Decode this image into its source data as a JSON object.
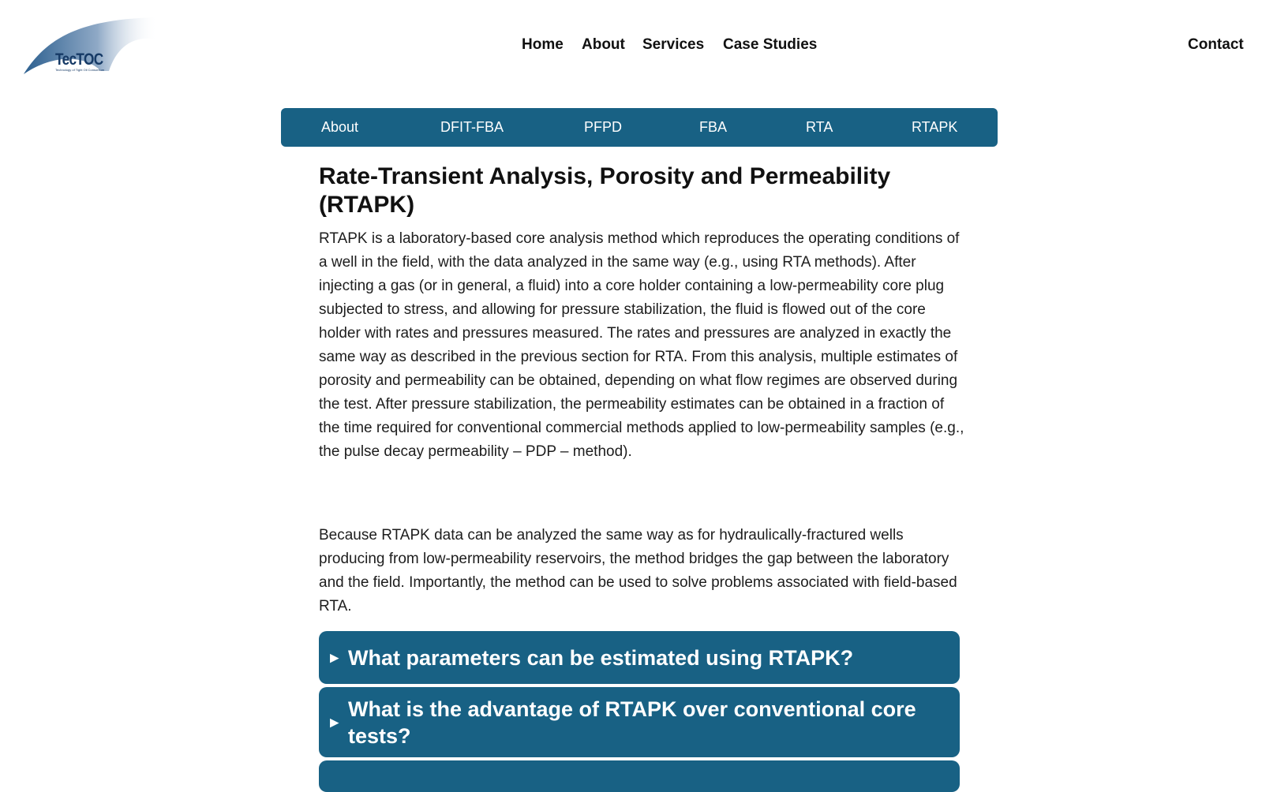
{
  "brand": {
    "name": "TecTOC",
    "tagline": "Technology of Tight Oil Consortium"
  },
  "nav": {
    "home": "Home",
    "about": "About",
    "services": "Services",
    "case_studies": "Case Studies",
    "contact": "Contact"
  },
  "subnav": [
    "About",
    "DFIT-FBA",
    "PFPD",
    "FBA",
    "RTA",
    "RTAPK"
  ],
  "page": {
    "title": "Rate-Transient Analysis, Porosity and Permeability (RTAPK)",
    "paragraphs": [
      "RTAPK is a laboratory-based core analysis method which reproduces the operating conditions of a well in the field, with the data analyzed in the same way (e.g., using RTA methods). After injecting a gas (or in general, a fluid) into a core holder containing a low-permeability core plug subjected to stress, and allowing for pressure stabilization, the fluid is flowed out of the core holder with rates and pressures measured. The rates and pressures are analyzed in exactly the same way as described in the previous section for RTA. From this analysis, multiple estimates of porosity and permeability can be obtained, depending on what flow regimes are observed during the test. After pressure stabilization, the permeability estimates can be obtained in a fraction of the time required for conventional commercial methods applied to low-permeability samples (e.g., the pulse decay permeability – PDP – method).",
      "Because RTAPK data can be analyzed the same way as for hydraulically-fractured wells producing from low-permeability reservoirs, the method bridges the gap between the laboratory and the field. Importantly, the method can be used to solve problems associated with field-based RTA."
    ]
  },
  "faq": [
    {
      "marker": "▶",
      "question": "What parameters can be estimated using RTAPK?"
    },
    {
      "marker": "▶",
      "question": "What is the advantage of RTAPK over conventional core tests?"
    }
  ],
  "colors": {
    "accent": "#186184",
    "text": "#1d1d1d",
    "logo_dark": "#163a66"
  }
}
